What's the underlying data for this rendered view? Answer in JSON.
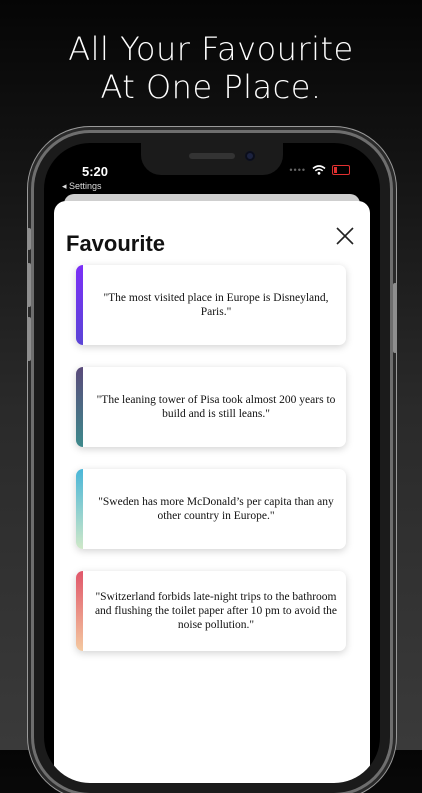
{
  "headline": {
    "line1": "All Your Favourite",
    "line2": "At One Place."
  },
  "status_bar": {
    "time": "5:20",
    "back_label": "◂ Settings"
  },
  "sheet": {
    "title": "Favourite",
    "close_icon": "close-icon"
  },
  "cards": [
    {
      "quote": "\"The most visited place in Europe is Disneyland, Paris.\"",
      "accent": [
        "#7b2ff7",
        "#5b45d6"
      ]
    },
    {
      "quote": "\"The leaning tower of Pisa took almost 200 years to build and is still leans.\"",
      "accent": [
        "#5a4a7a",
        "#3e8a8c"
      ]
    },
    {
      "quote": "\"Sweden has more McDonald’s per capita than any other country in Europe.\"",
      "accent": [
        "#4ab6d8",
        "#cfe8c8"
      ]
    },
    {
      "quote": "\"Switzerland forbids late-night trips to the bathroom and flushing the toilet paper after 10 pm to avoid the noise pollution.\"",
      "accent": [
        "#e0566a",
        "#f4c9a0"
      ]
    }
  ]
}
